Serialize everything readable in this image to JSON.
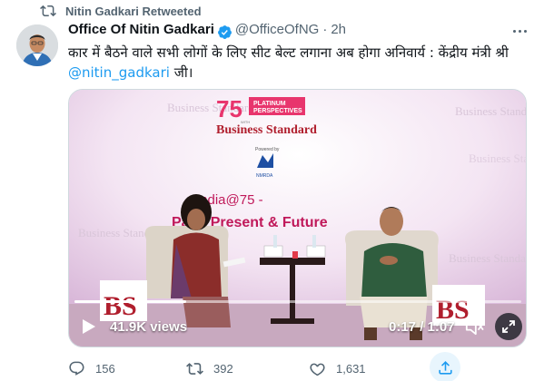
{
  "retweet_banner": {
    "label": "Nitin Gadkari Retweeted",
    "icon": "retweet-icon"
  },
  "tweet": {
    "author_name": "Office Of Nitin Gadkari",
    "verified_icon": "verified-badge-icon",
    "handle": "@OfficeOfNG",
    "separator": "·",
    "timestamp": "2h",
    "text": "कार में बैठने वाले सभी लोगों के लिए सीट बेल्ट लगाना अब होगा अनिवार्य : केंद्रीय मंत्री श्री",
    "mention": "@nitin_gadkari",
    "text_suffix": " जी।"
  },
  "video": {
    "views": "41.9K views",
    "timecode": "0:17 / 1:07",
    "progress": 0.25,
    "backdrop": {
      "badge_number": "75",
      "badge_line1": "PLATINUM",
      "badge_line2": "PERSPECTIVES",
      "badge_with": "WITH",
      "brand": "Business Standard",
      "powered_by": "Powered by",
      "sponsor": "NMRDA",
      "event_title": "India@75 -",
      "event_subtitle": "Past, Present & Future",
      "watermark": "Business Standard",
      "podium_logo": "BS"
    },
    "colors": {
      "accent_pink": "#e8356d",
      "brand_red": "#b01e2d",
      "stage_bg": "#f3e6f3"
    }
  },
  "actions": {
    "replies": "156",
    "retweets": "392",
    "likes": "1,631"
  },
  "colors": {
    "link_blue": "#1d9bf0",
    "muted_gray": "#536471"
  }
}
